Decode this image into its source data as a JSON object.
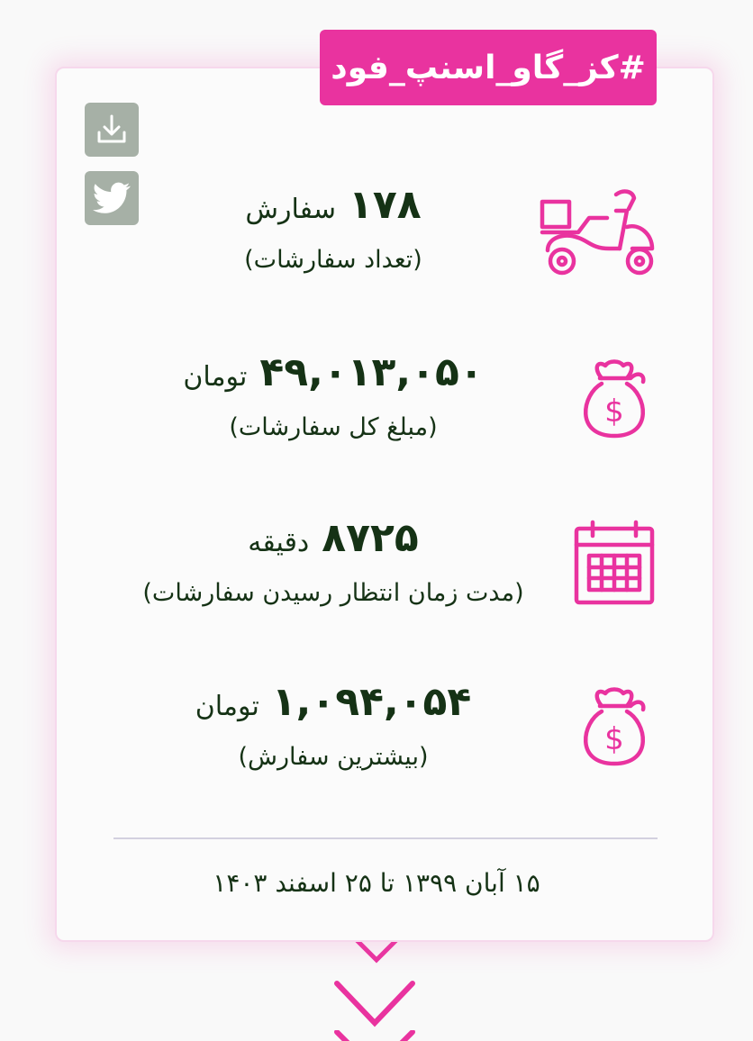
{
  "header": {
    "hashtag": "#کز_گاو_اسنپ_فود"
  },
  "actions": {
    "download_icon": "download-icon",
    "twitter_icon": "twitter-icon"
  },
  "stats": [
    {
      "icon": "scooter-icon",
      "value": "۱۷۸",
      "unit": "سفارش",
      "label": "(تعداد سفارشات)"
    },
    {
      "icon": "money-bag-icon",
      "value": "۴۹,۰۱۳,۰۵۰",
      "unit": "تومان",
      "label": "(مبلغ کل سفارشات)"
    },
    {
      "icon": "calendar-icon",
      "value": "۸۷۲۵",
      "unit": "دقیقه",
      "label": "(مدت زمان انتظار رسیدن سفارشات)"
    },
    {
      "icon": "money-bag-icon",
      "value": "۱,۰۹۴,۰۵۴",
      "unit": "تومان",
      "label": "(بیشترین سفارش)"
    }
  ],
  "footer": {
    "date_range": "۱۵ آبان ۱۳۹۹ تا ۲۵ اسفند ۱۴۰۳"
  },
  "colors": {
    "accent": "#e9339f",
    "text": "#153215",
    "button": "#a6b0a6"
  }
}
